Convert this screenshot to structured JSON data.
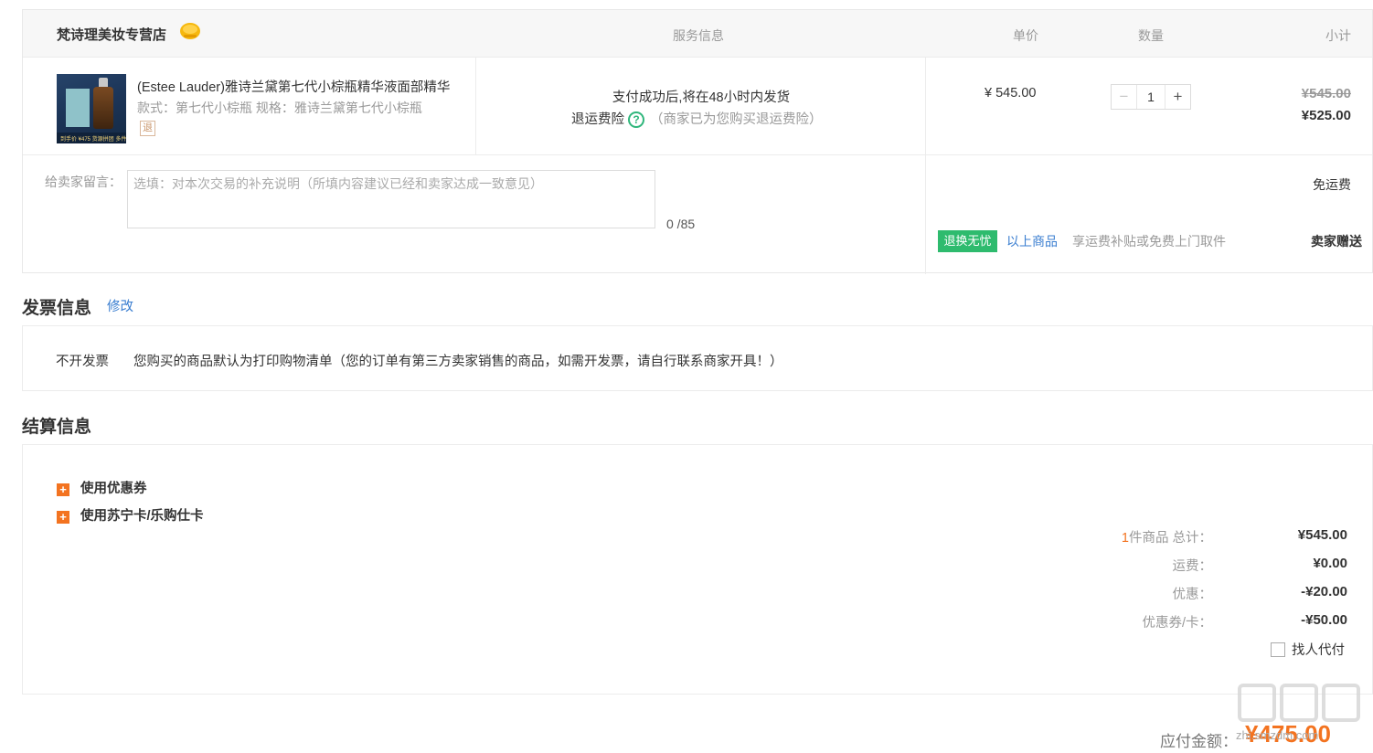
{
  "order": {
    "shop_name": "梵诗理美妆专营店",
    "shop_icon": "orange-badge-icon",
    "columns": {
      "service": "服务信息",
      "unit_price": "单价",
      "quantity": "数量",
      "subtotal": "小计"
    },
    "product": {
      "title": "(Estee Lauder)雅诗兰黛第七代小棕瓶精华液面部精华",
      "spec": "款式：第七代小棕瓶   规格：雅诗兰黛第七代小棕瓶",
      "return_badge": "退",
      "thumb_caption": "到手价 ¥475  货源拼团  多件优惠"
    },
    "service": {
      "delivery": "支付成功后,将在48小时内发货",
      "insurance_label": "退运费险",
      "insurance_note": "（商家已为您购买退运费险）"
    },
    "unit_price": "¥ 545.00",
    "quantity": {
      "minus": "−",
      "value": "1",
      "plus": "+"
    },
    "subtotal": {
      "original": "¥545.00",
      "final": "¥525.00"
    },
    "message": {
      "label": "给卖家留言：",
      "placeholder": "选填：对本次交易的补充说明（所填内容建议已经和卖家达成一致意见）",
      "value": "",
      "count": "0 /85"
    },
    "shipping": {
      "free": "免运费",
      "return_badge": "退换无忧",
      "link": "以上商品",
      "desc": "享运费补贴或免费上门取件",
      "gift": "卖家赠送"
    }
  },
  "invoice": {
    "title": "发票信息",
    "edit": "修改",
    "type": "不开发票",
    "desc": "您购买的商品默认为打印购物清单（您的订单有第三方卖家销售的商品，如需开发票，请自行联系商家开具！）"
  },
  "settlement": {
    "title": "结算信息",
    "options": [
      "使用优惠券",
      "使用苏宁卡/乐购仕卡"
    ],
    "summary": {
      "count": "1",
      "items_label": "件商品 总计：",
      "items_value": "¥545.00",
      "shipping_label": "运费：",
      "shipping_value": "¥0.00",
      "discount_label": "优惠：",
      "discount_value": "-¥20.00",
      "coupon_label": "优惠券/卡：",
      "coupon_value": "-¥50.00"
    },
    "agent_pay": "找人代付"
  },
  "payment": {
    "label": "应付金额：",
    "amount": "¥475.00"
  },
  "watermark": {
    "url": "zhi.smzdm.com"
  },
  "colors": {
    "accent": "#f37320",
    "link": "#3a7ed0",
    "green": "#2ebb6e"
  }
}
